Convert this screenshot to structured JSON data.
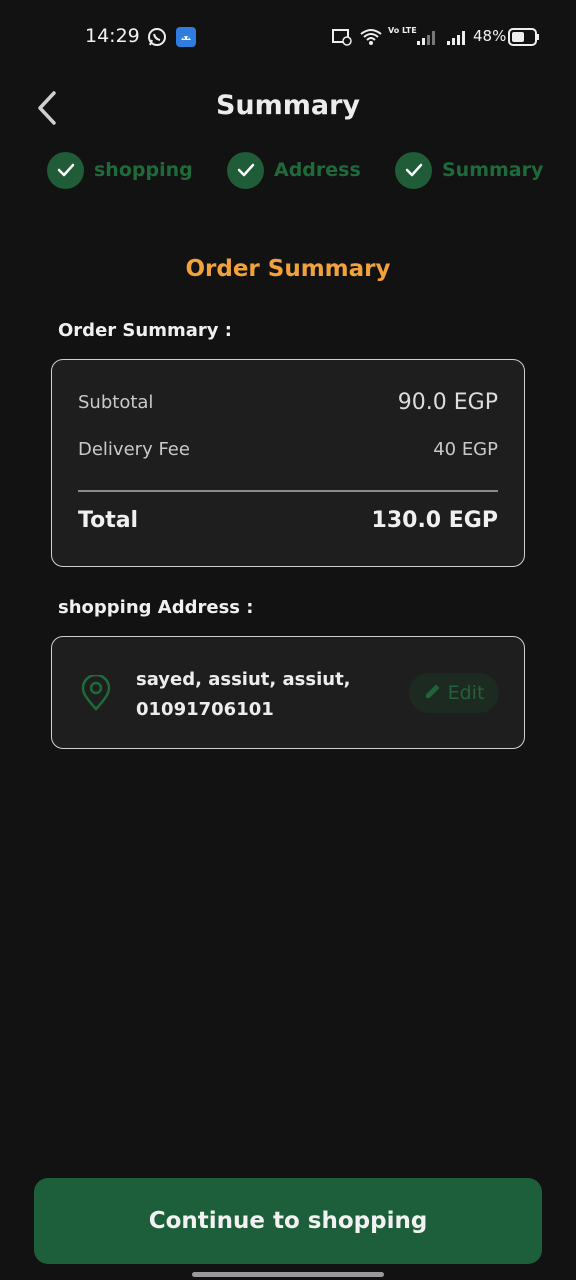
{
  "status_bar": {
    "time": "14:29",
    "battery_percent": "48%",
    "network_label": "Vo LTE",
    "icons": [
      "whatsapp-icon",
      "app-notification-icon",
      "cast-icon",
      "wifi-icon",
      "signal-icon",
      "signal-icon",
      "battery-icon"
    ]
  },
  "header": {
    "title": "Summary",
    "back_icon": "chevron-left-icon"
  },
  "steps": [
    {
      "label": "shopping",
      "icon": "check-icon",
      "done": true
    },
    {
      "label": "Address",
      "icon": "check-icon",
      "done": true
    },
    {
      "label": "Summary",
      "icon": "check-icon",
      "done": true
    }
  ],
  "section_title": "Order Summary",
  "order_summary": {
    "heading": "Order Summary :",
    "subtotal_label": "Subtotal",
    "subtotal_value": "90.0 EGP",
    "delivery_label": "Delivery Fee",
    "delivery_value": "40 EGP",
    "total_label": "Total",
    "total_value": "130.0 EGP"
  },
  "shipping": {
    "heading": "shopping Address :",
    "address_line1": "sayed, assiut, assiut,",
    "address_line2": "01091706101",
    "icon": "location-pin-icon",
    "edit_label": "Edit",
    "edit_icon": "pencil-icon"
  },
  "cta": {
    "label": "Continue to shopping"
  },
  "colors": {
    "background": "#121212",
    "accent_green": "#1e5f3b",
    "accent_orange": "#f1a23a"
  }
}
